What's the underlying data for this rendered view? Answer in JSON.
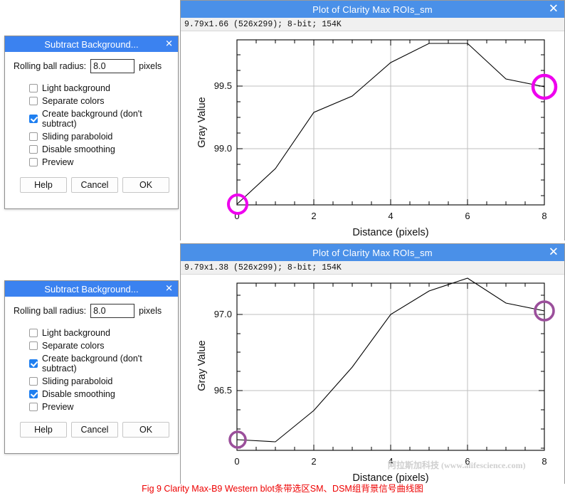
{
  "caption": "Fig 9 Clarity Max-B9 Western blot条带选区SM、DSM组背景信号曲线图",
  "watermark": "阿拉斯加科技 (www.alifescience.com)",
  "colors": {
    "titlebar": "#4a90e8",
    "dialog_titlebar": "#3b82f0",
    "checkbox_checked": "#1f7ff0",
    "marker_top": "#ee00ee",
    "marker_bottom": "#9b4f9b",
    "caption": "#ee0000",
    "grid": "#bfbfbf",
    "curve": "#000000"
  },
  "plots": [
    {
      "title": "Plot of Clarity Max ROIs_sm",
      "close_label": "✕",
      "info": "9.79x1.66  (526x299); 8-bit; 154K"
    },
    {
      "title": "Plot of Clarity Max ROIs_sm",
      "close_label": "✕",
      "info": "9.79x1.38  (526x299); 8-bit; 154K"
    }
  ],
  "dialogs": [
    {
      "title": "Subtract Background...",
      "close_label": "✕",
      "radius_label": "Rolling ball radius:",
      "radius_value": "8.0",
      "radius_unit": "pixels",
      "options": [
        {
          "label": "Light background",
          "checked": false
        },
        {
          "label": "Separate colors",
          "checked": false
        },
        {
          "label": "Create background (don't subtract)",
          "checked": true
        },
        {
          "label": "Sliding paraboloid",
          "checked": false
        },
        {
          "label": "Disable smoothing",
          "checked": false
        },
        {
          "label": "Preview",
          "checked": false
        }
      ],
      "buttons": [
        "Help",
        "Cancel",
        "OK"
      ]
    },
    {
      "title": "Subtract Background...",
      "close_label": "✕",
      "radius_label": "Rolling ball radius:",
      "radius_value": "8.0",
      "radius_unit": "pixels",
      "options": [
        {
          "label": "Light background",
          "checked": false
        },
        {
          "label": "Separate colors",
          "checked": false
        },
        {
          "label": "Create background (don't subtract)",
          "checked": true
        },
        {
          "label": "Sliding paraboloid",
          "checked": false
        },
        {
          "label": "Disable smoothing",
          "checked": true
        },
        {
          "label": "Preview",
          "checked": false
        }
      ],
      "buttons": [
        "Help",
        "Cancel",
        "OK"
      ]
    }
  ],
  "chart_data": [
    {
      "type": "line",
      "title": "Plot of Clarity Max ROIs_sm",
      "xlabel": "Distance (pixels)",
      "ylabel": "Gray Value",
      "x": [
        0,
        1,
        2,
        3,
        4,
        5,
        6,
        7,
        8
      ],
      "values": [
        98.56,
        98.84,
        99.29,
        99.42,
        99.69,
        99.84,
        99.84,
        99.56,
        99.49
      ],
      "xticks": [
        0,
        2,
        4,
        6,
        8
      ],
      "yticks": [
        99.0,
        99.5
      ],
      "xlim": [
        0,
        8
      ],
      "ylim": [
        98.56,
        99.87
      ],
      "grid": true,
      "annotations": [
        {
          "kind": "circle-marker",
          "x": 0,
          "y": 98.56,
          "color": "#ee00ee"
        },
        {
          "kind": "circle-marker",
          "x": 8,
          "y": 99.49,
          "color": "#ee00ee"
        }
      ]
    },
    {
      "type": "line",
      "title": "Plot of Clarity Max ROIs_sm",
      "xlabel": "Distance (pixels)",
      "ylabel": "Gray Value",
      "x": [
        0,
        1,
        2,
        3,
        4,
        5,
        6,
        7,
        8
      ],
      "values": [
        96.18,
        96.17,
        96.37,
        96.66,
        97.0,
        97.16,
        97.24,
        97.08,
        97.03
      ],
      "xticks": [
        0,
        2,
        4,
        6,
        8
      ],
      "yticks": [
        96.5,
        97.0
      ],
      "xlim": [
        0,
        8
      ],
      "ylim": [
        96.14,
        97.28
      ],
      "grid": true,
      "annotations": [
        {
          "kind": "circle-marker",
          "x": 0,
          "y": 96.18,
          "color": "#9b4f9b"
        },
        {
          "kind": "circle-marker",
          "x": 8,
          "y": 97.03,
          "color": "#9b4f9b"
        }
      ]
    }
  ]
}
